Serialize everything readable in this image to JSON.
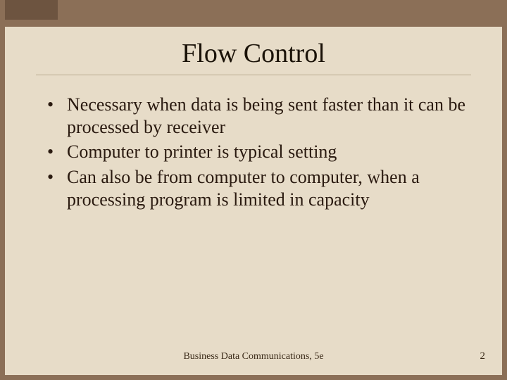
{
  "title": "Flow Control",
  "bullets": [
    "Necessary when data is being sent faster than it can be processed by receiver",
    "Computer to printer is typical setting",
    "Can also be from computer to computer, when a processing program is limited in capacity"
  ],
  "footer": "Business Data Communications, 5e",
  "page_number": "2"
}
